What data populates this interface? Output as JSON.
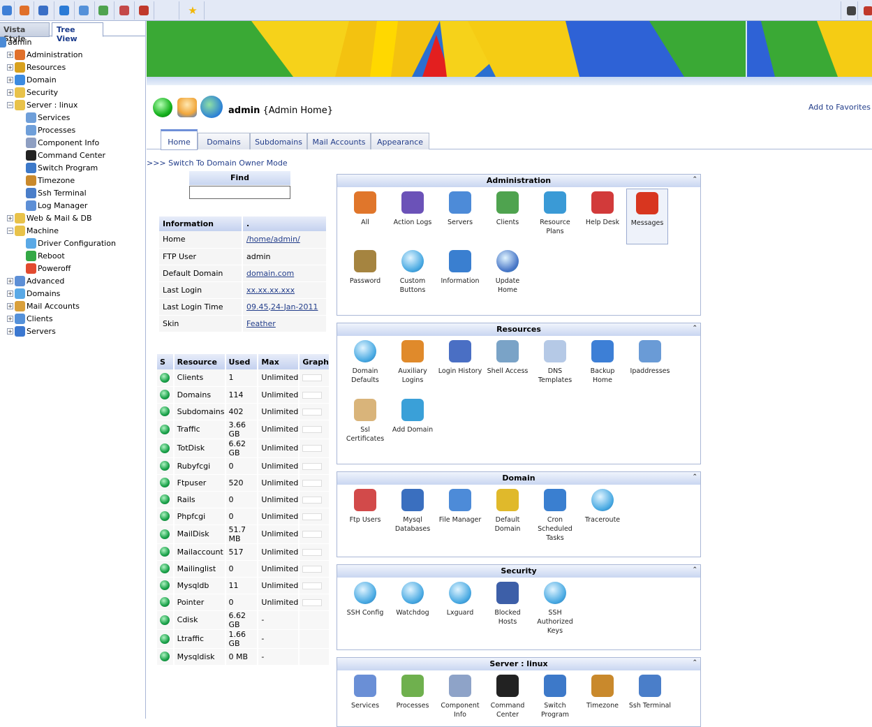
{
  "toolbar": {
    "icons": [
      "home-icon",
      "edit-icon",
      "network-icon",
      "box-icon",
      "people-icon",
      "tree-icon",
      "user-icon",
      "logout-icon",
      "star-icon"
    ],
    "right_icons": [
      "mute-icon",
      "exit-icon"
    ]
  },
  "left_pane": {
    "tabs": [
      "Vista Style",
      "Tree View"
    ],
    "root": "admin",
    "items": [
      {
        "label": "Administration",
        "depth": 1,
        "expander": "+"
      },
      {
        "label": "Resources",
        "depth": 1,
        "expander": "+"
      },
      {
        "label": "Domain",
        "depth": 1,
        "expander": "+"
      },
      {
        "label": "Security",
        "depth": 1,
        "expander": "+"
      },
      {
        "label": "Server  : linux",
        "depth": 1,
        "expander": "-"
      },
      {
        "label": "Services",
        "depth": 2
      },
      {
        "label": "Processes",
        "depth": 2
      },
      {
        "label": "Component Info",
        "depth": 2
      },
      {
        "label": "Command Center",
        "depth": 2
      },
      {
        "label": "Switch Program",
        "depth": 2
      },
      {
        "label": "Timezone",
        "depth": 2
      },
      {
        "label": "Ssh Terminal",
        "depth": 2
      },
      {
        "label": "Log Manager",
        "depth": 2
      },
      {
        "label": "Web & Mail & DB",
        "depth": 1,
        "expander": "+"
      },
      {
        "label": "Machine",
        "depth": 1,
        "expander": "-"
      },
      {
        "label": "Driver Configuration",
        "depth": 2
      },
      {
        "label": "Reboot",
        "depth": 2
      },
      {
        "label": "Poweroff",
        "depth": 2
      },
      {
        "label": "Advanced",
        "depth": 1,
        "expander": "+"
      },
      {
        "label": "Domains",
        "depth": 1,
        "expander": "+"
      },
      {
        "label": "Mail Accounts",
        "depth": 1,
        "expander": "+"
      },
      {
        "label": "Clients",
        "depth": 1,
        "expander": "+"
      },
      {
        "label": "Servers",
        "depth": 1,
        "expander": "+"
      }
    ]
  },
  "header": {
    "user": "admin",
    "subtitle": "{Admin Home}",
    "add_to_favorites": "Add to Favorites"
  },
  "tabs": [
    "Home",
    "Domains",
    "Subdomains",
    "Mail Accounts",
    "Appearance"
  ],
  "switch_mode": ">>> Switch To Domain Owner Mode",
  "find": {
    "title": "Find",
    "value": ""
  },
  "info": {
    "header": [
      "Information",
      "."
    ],
    "rows": [
      {
        "label": "Home",
        "value": "/home/admin/",
        "link": true
      },
      {
        "label": "FTP User",
        "value": "admin",
        "link": false
      },
      {
        "label": "Default Domain",
        "value": "domain.com",
        "link": true
      },
      {
        "label": "Last Login",
        "value": "xx.xx.xx.xxx",
        "link": true
      },
      {
        "label": "Last Login Time",
        "value": "09.45,24-Jan-2011",
        "link": true
      },
      {
        "label": "Skin",
        "value": "Feather",
        "link": true
      }
    ]
  },
  "resources_table": {
    "headers": [
      "S",
      "Resource",
      "Used",
      "Max",
      "Graph"
    ],
    "rows": [
      [
        "Clients",
        "1",
        "Unlimited"
      ],
      [
        "Domains",
        "114",
        "Unlimited"
      ],
      [
        "Subdomains",
        "402",
        "Unlimited"
      ],
      [
        "Traffic",
        "3.66 GB",
        "Unlimited"
      ],
      [
        "TotDisk",
        "6.62 GB",
        "Unlimited"
      ],
      [
        "Rubyfcgi",
        "0",
        "Unlimited"
      ],
      [
        "Ftpuser",
        "520",
        "Unlimited"
      ],
      [
        "Rails",
        "0",
        "Unlimited"
      ],
      [
        "Phpfcgi",
        "0",
        "Unlimited"
      ],
      [
        "MailDisk",
        "51.7 MB",
        "Unlimited"
      ],
      [
        "Mailaccount",
        "517",
        "Unlimited"
      ],
      [
        "Mailinglist",
        "0",
        "Unlimited"
      ],
      [
        "Mysqldb",
        "11",
        "Unlimited"
      ],
      [
        "Pointer",
        "0",
        "Unlimited"
      ],
      [
        "Cdisk",
        "6.62 GB",
        "-"
      ],
      [
        "Ltraffic",
        "1.66 GB",
        "-"
      ],
      [
        "Mysqldisk",
        "0 MB",
        "-"
      ]
    ]
  },
  "panels": [
    {
      "title": "Administration",
      "items": [
        "All",
        "Action Logs",
        "Servers",
        "Clients",
        "Resource Plans",
        "Help Desk",
        "Messages",
        "Password",
        "Custom Buttons",
        "Information",
        "Update Home"
      ]
    },
    {
      "title": "Resources",
      "items": [
        "Domain Defaults",
        "Auxiliary Logins",
        "Login History",
        "Shell Access",
        "DNS Templates",
        "Backup Home",
        "Ipaddresses",
        "Ssl Certificates",
        "Add Domain"
      ]
    },
    {
      "title": "Domain",
      "items": [
        "Ftp Users",
        "Mysql Databases",
        "File Manager",
        "Default Domain",
        "Cron Scheduled Tasks",
        "Traceroute"
      ]
    },
    {
      "title": "Security",
      "items": [
        "SSH Config",
        "Watchdog",
        "Lxguard",
        "Blocked Hosts",
        "SSH Authorized Keys"
      ]
    },
    {
      "title": "Server : linux",
      "items": [
        "Services",
        "Processes",
        "Component Info",
        "Command Center",
        "Switch Program",
        "Timezone",
        "Ssh Terminal"
      ]
    }
  ],
  "colors": {
    "accent": "#223d8a",
    "header_grad": "#c4d1ef",
    "status_green": "#18a048"
  }
}
